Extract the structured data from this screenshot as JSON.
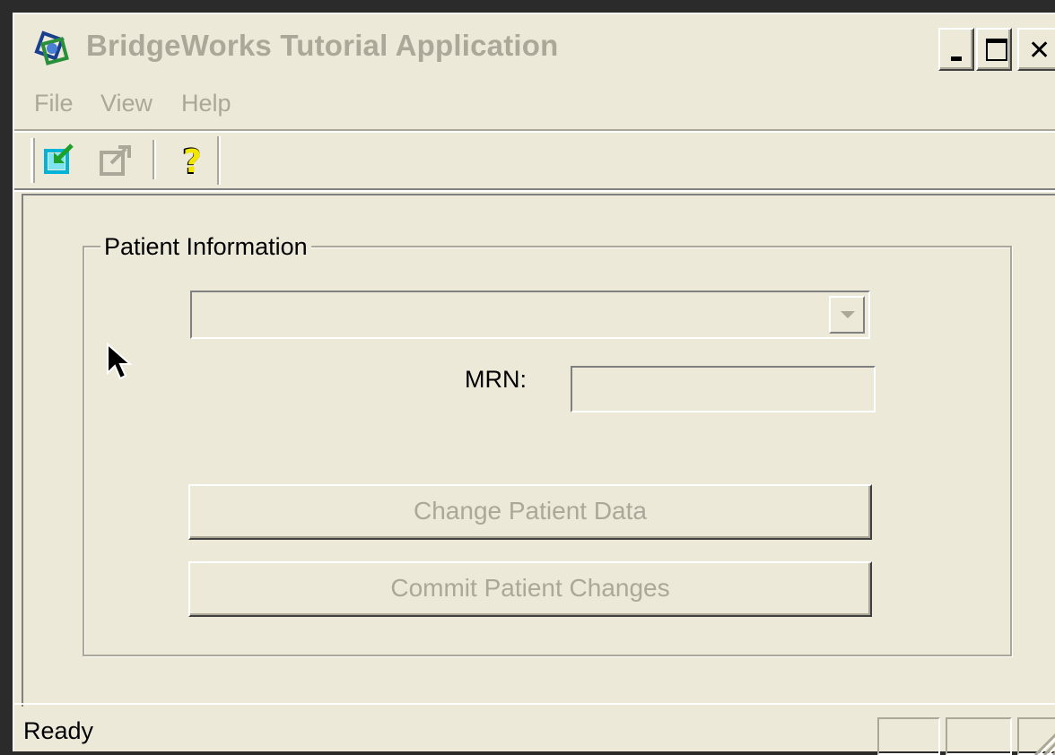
{
  "window": {
    "title": "BridgeWorks Tutorial Application",
    "icon": "bridgeworks-app-icon",
    "controls": {
      "minimize": "minimize-icon",
      "maximize": "maximize-icon",
      "close": "✕"
    }
  },
  "menubar": {
    "items": [
      {
        "label": "File"
      },
      {
        "label": "View"
      },
      {
        "label": "Help"
      }
    ]
  },
  "toolbar": {
    "buttons": [
      {
        "icon": "import-icon",
        "enabled": true
      },
      {
        "icon": "export-icon",
        "enabled": false
      },
      {
        "icon": "help-question-icon",
        "enabled": true
      }
    ]
  },
  "patient_info": {
    "group_label": "Patient Information",
    "patient_select": {
      "value": "",
      "enabled": false
    },
    "mrn_label": "MRN:",
    "mrn_value": "",
    "change_button": "Change Patient Data",
    "commit_button": "Commit Patient Changes"
  },
  "statusbar": {
    "text": "Ready"
  },
  "colors": {
    "face": "#ece9d8",
    "disabled_text": "#aca899",
    "highlight": "#ffffff",
    "shadow": "#808080"
  }
}
